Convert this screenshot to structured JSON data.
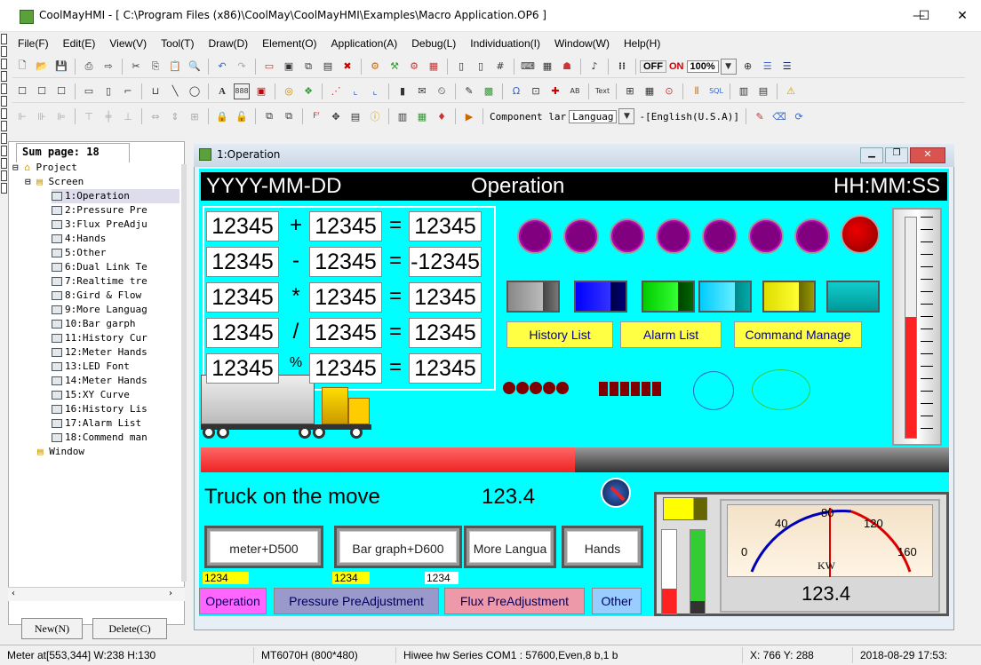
{
  "window": {
    "title": "CoolMayHMI - [ C:\\Program Files (x86)\\CoolMay\\CoolMayHMI\\Examples\\Macro Application.OP6 ]",
    "minimize": "—",
    "maximize": "☐",
    "close": "✕"
  },
  "menu": [
    "File(F)",
    "Edit(E)",
    "View(V)",
    "Tool(T)",
    "Draw(D)",
    "Element(O)",
    "Application(A)",
    "Debug(L)",
    "Individuation(I)",
    "Window(W)",
    "Help(H)"
  ],
  "toolbar": {
    "off_label": "OFF",
    "on_label": "ON",
    "zoom_value": "100%",
    "component_label": "Component lar",
    "language_select": "Languag",
    "language_value": "-[English(U.S.A)]"
  },
  "sidebar": {
    "sum_page": "Sum page: 18",
    "project_label": "Project",
    "screen_label": "Screen",
    "screens": [
      "1:Operation",
      "2:Pressure Pre",
      "3:Flux PreAdju",
      "4:Hands",
      "5:Other",
      "6:Dual Link Te",
      "7:Realtime tre",
      "8:Gird & Flow",
      "9:More Languag",
      "10:Bar garph",
      "11:History Cur",
      "12:Meter Hands",
      "13:LED Font",
      "14:Meter Hands",
      "15:XY Curve",
      "16:History Lis",
      "17:Alarm List",
      "18:Commend man"
    ],
    "window_label": "Window",
    "new_button": "New(N)",
    "delete_button": "Delete(C)"
  },
  "child_window": {
    "title": "1:Operation"
  },
  "hmi": {
    "header_date": "YYYY-MM-DD",
    "header_title": "Operation",
    "header_time": "HH:MM:SS",
    "calc_rows": [
      {
        "a": "12345",
        "op": "+",
        "b": "12345",
        "eq": "=",
        "r": "12345"
      },
      {
        "a": "12345",
        "op": "-",
        "b": "12345",
        "eq": "=",
        "r": "-12345"
      },
      {
        "a": "12345",
        "op": "*",
        "b": "12345",
        "eq": "=",
        "r": "12345"
      },
      {
        "a": "12345",
        "op": "/",
        "b": "12345",
        "eq": "=",
        "r": "12345"
      },
      {
        "a": "12345",
        "op": "%",
        "b": "12345",
        "eq": "=",
        "r": "12345"
      }
    ],
    "buttons_yellow": [
      "History List",
      "Alarm List",
      "Command Manage"
    ],
    "truck_text": "Truck on the move",
    "truck_number": "123.4",
    "progress_fraction": 0.5,
    "thermo_fraction": 0.55,
    "bar_left_fraction": 0.3,
    "bar_right_fraction": 0.85,
    "nav_buttons": [
      "meter+D500",
      "Bar graph+D600",
      "More Langua",
      "Hands"
    ],
    "small_values": [
      "1234",
      "1234",
      "1234"
    ],
    "page_buttons": [
      "Operation",
      "Pressure PreAdjustment",
      "Flux PreAdjustment",
      "Other"
    ],
    "meter_ticks": [
      "0",
      "40",
      "80",
      "120",
      "160"
    ],
    "meter_unit": "KW",
    "meter_value": "123.4"
  },
  "status": {
    "selection": "Meter at[553,344] W:238  H:130",
    "model": "MT6070H (800*480)",
    "comm": "Hiwee hw Series  COM1 : 57600,Even,8 b,1 b",
    "coords": "X: 766  Y: 288",
    "datetime": "2018-08-29 17:53:"
  },
  "colors": {
    "hmi_bg": "#00ffff",
    "lamp": "#800080",
    "yellow_button": "#ffff44"
  }
}
